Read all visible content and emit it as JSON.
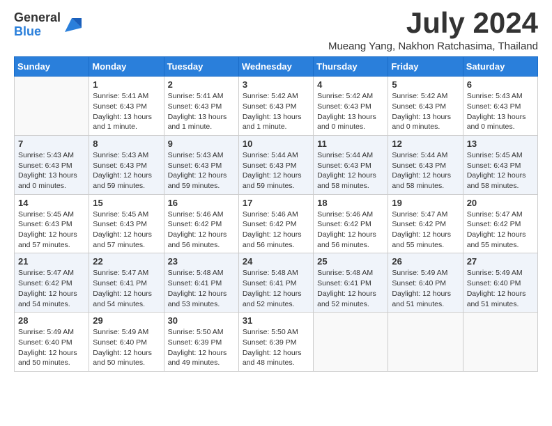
{
  "header": {
    "logo_general": "General",
    "logo_blue": "Blue",
    "month_title": "July 2024",
    "location": "Mueang Yang, Nakhon Ratchasima, Thailand"
  },
  "weekdays": [
    "Sunday",
    "Monday",
    "Tuesday",
    "Wednesday",
    "Thursday",
    "Friday",
    "Saturday"
  ],
  "weeks": [
    [
      {
        "day": "",
        "info": ""
      },
      {
        "day": "1",
        "info": "Sunrise: 5:41 AM\nSunset: 6:43 PM\nDaylight: 13 hours\nand 1 minute."
      },
      {
        "day": "2",
        "info": "Sunrise: 5:41 AM\nSunset: 6:43 PM\nDaylight: 13 hours\nand 1 minute."
      },
      {
        "day": "3",
        "info": "Sunrise: 5:42 AM\nSunset: 6:43 PM\nDaylight: 13 hours\nand 1 minute."
      },
      {
        "day": "4",
        "info": "Sunrise: 5:42 AM\nSunset: 6:43 PM\nDaylight: 13 hours\nand 0 minutes."
      },
      {
        "day": "5",
        "info": "Sunrise: 5:42 AM\nSunset: 6:43 PM\nDaylight: 13 hours\nand 0 minutes."
      },
      {
        "day": "6",
        "info": "Sunrise: 5:43 AM\nSunset: 6:43 PM\nDaylight: 13 hours\nand 0 minutes."
      }
    ],
    [
      {
        "day": "7",
        "info": "Sunrise: 5:43 AM\nSunset: 6:43 PM\nDaylight: 13 hours\nand 0 minutes."
      },
      {
        "day": "8",
        "info": "Sunrise: 5:43 AM\nSunset: 6:43 PM\nDaylight: 12 hours\nand 59 minutes."
      },
      {
        "day": "9",
        "info": "Sunrise: 5:43 AM\nSunset: 6:43 PM\nDaylight: 12 hours\nand 59 minutes."
      },
      {
        "day": "10",
        "info": "Sunrise: 5:44 AM\nSunset: 6:43 PM\nDaylight: 12 hours\nand 59 minutes."
      },
      {
        "day": "11",
        "info": "Sunrise: 5:44 AM\nSunset: 6:43 PM\nDaylight: 12 hours\nand 58 minutes."
      },
      {
        "day": "12",
        "info": "Sunrise: 5:44 AM\nSunset: 6:43 PM\nDaylight: 12 hours\nand 58 minutes."
      },
      {
        "day": "13",
        "info": "Sunrise: 5:45 AM\nSunset: 6:43 PM\nDaylight: 12 hours\nand 58 minutes."
      }
    ],
    [
      {
        "day": "14",
        "info": "Sunrise: 5:45 AM\nSunset: 6:43 PM\nDaylight: 12 hours\nand 57 minutes."
      },
      {
        "day": "15",
        "info": "Sunrise: 5:45 AM\nSunset: 6:43 PM\nDaylight: 12 hours\nand 57 minutes."
      },
      {
        "day": "16",
        "info": "Sunrise: 5:46 AM\nSunset: 6:42 PM\nDaylight: 12 hours\nand 56 minutes."
      },
      {
        "day": "17",
        "info": "Sunrise: 5:46 AM\nSunset: 6:42 PM\nDaylight: 12 hours\nand 56 minutes."
      },
      {
        "day": "18",
        "info": "Sunrise: 5:46 AM\nSunset: 6:42 PM\nDaylight: 12 hours\nand 56 minutes."
      },
      {
        "day": "19",
        "info": "Sunrise: 5:47 AM\nSunset: 6:42 PM\nDaylight: 12 hours\nand 55 minutes."
      },
      {
        "day": "20",
        "info": "Sunrise: 5:47 AM\nSunset: 6:42 PM\nDaylight: 12 hours\nand 55 minutes."
      }
    ],
    [
      {
        "day": "21",
        "info": "Sunrise: 5:47 AM\nSunset: 6:42 PM\nDaylight: 12 hours\nand 54 minutes."
      },
      {
        "day": "22",
        "info": "Sunrise: 5:47 AM\nSunset: 6:41 PM\nDaylight: 12 hours\nand 54 minutes."
      },
      {
        "day": "23",
        "info": "Sunrise: 5:48 AM\nSunset: 6:41 PM\nDaylight: 12 hours\nand 53 minutes."
      },
      {
        "day": "24",
        "info": "Sunrise: 5:48 AM\nSunset: 6:41 PM\nDaylight: 12 hours\nand 52 minutes."
      },
      {
        "day": "25",
        "info": "Sunrise: 5:48 AM\nSunset: 6:41 PM\nDaylight: 12 hours\nand 52 minutes."
      },
      {
        "day": "26",
        "info": "Sunrise: 5:49 AM\nSunset: 6:40 PM\nDaylight: 12 hours\nand 51 minutes."
      },
      {
        "day": "27",
        "info": "Sunrise: 5:49 AM\nSunset: 6:40 PM\nDaylight: 12 hours\nand 51 minutes."
      }
    ],
    [
      {
        "day": "28",
        "info": "Sunrise: 5:49 AM\nSunset: 6:40 PM\nDaylight: 12 hours\nand 50 minutes."
      },
      {
        "day": "29",
        "info": "Sunrise: 5:49 AM\nSunset: 6:40 PM\nDaylight: 12 hours\nand 50 minutes."
      },
      {
        "day": "30",
        "info": "Sunrise: 5:50 AM\nSunset: 6:39 PM\nDaylight: 12 hours\nand 49 minutes."
      },
      {
        "day": "31",
        "info": "Sunrise: 5:50 AM\nSunset: 6:39 PM\nDaylight: 12 hours\nand 48 minutes."
      },
      {
        "day": "",
        "info": ""
      },
      {
        "day": "",
        "info": ""
      },
      {
        "day": "",
        "info": ""
      }
    ]
  ]
}
